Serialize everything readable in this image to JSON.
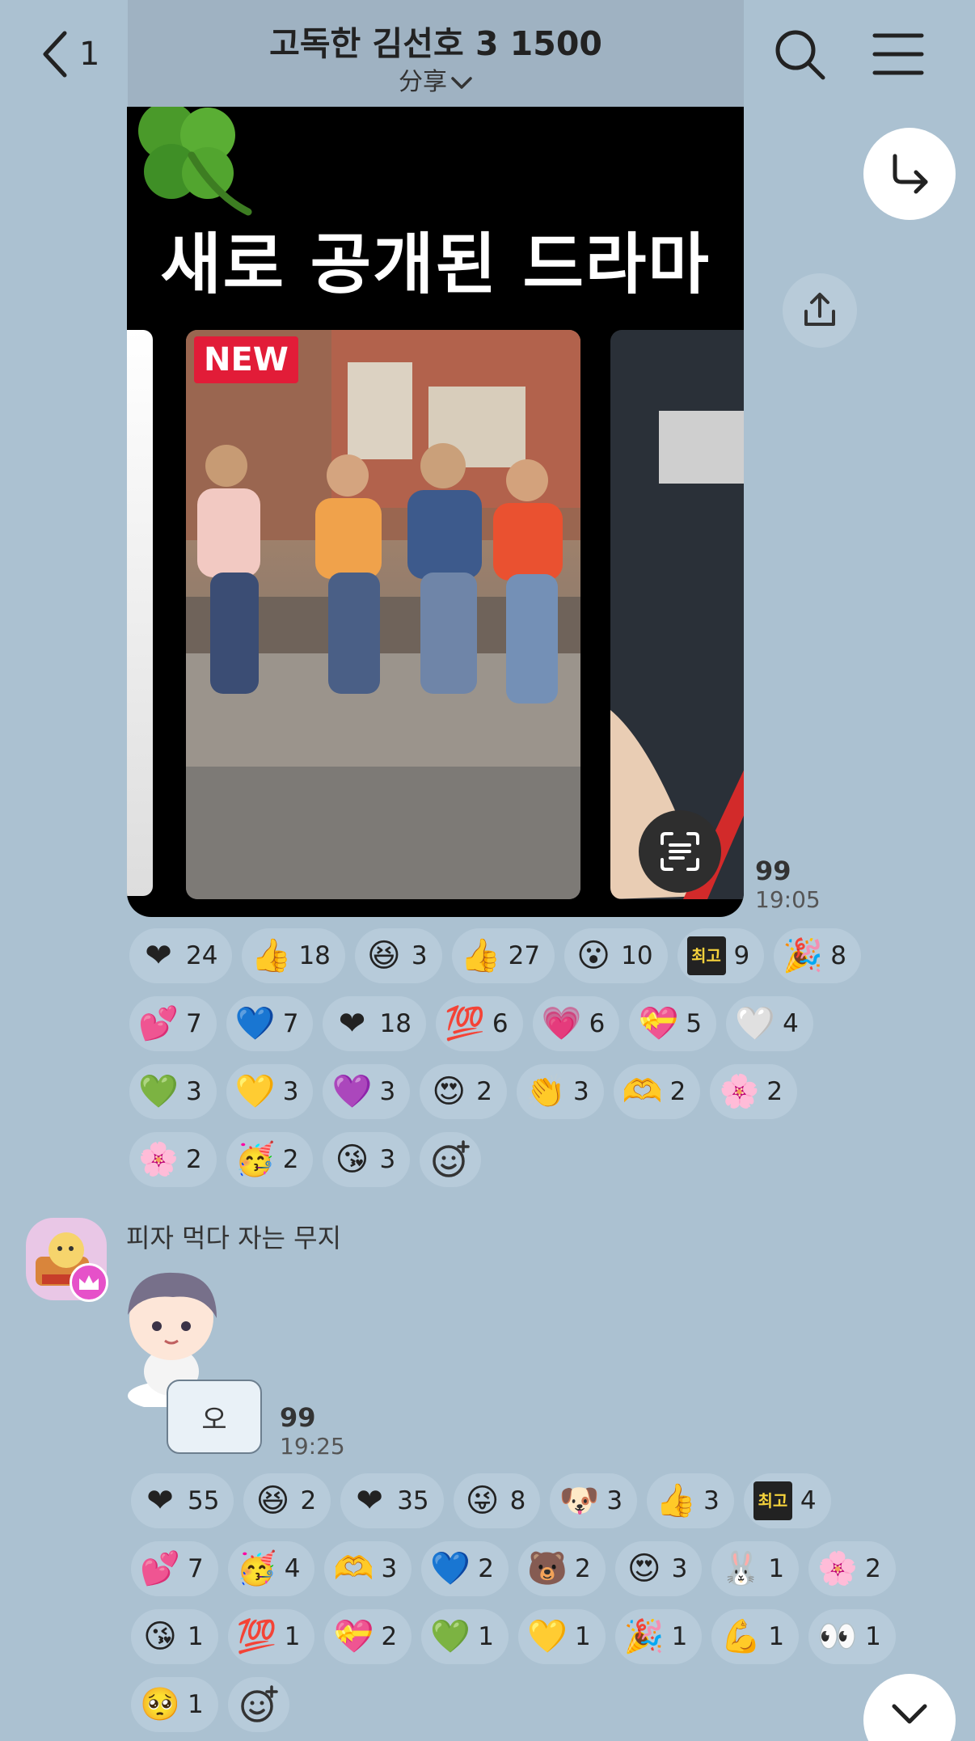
{
  "header": {
    "back_count": "1",
    "title": "고독한 김선호 3 1500",
    "subtitle": "分享"
  },
  "message1": {
    "card_title": "새로 공개된 드라마",
    "badge": "NEW",
    "unread": "99",
    "time": "19:05",
    "reactions": [
      {
        "icon": "heart-circle-icon",
        "glyph": "❤",
        "count": "24"
      },
      {
        "icon": "thumbs-up-circle-icon",
        "glyph": "👍",
        "count": "18"
      },
      {
        "icon": "grinning-squint-icon",
        "glyph": "😆",
        "count": "3"
      },
      {
        "icon": "thumbs-up-icon",
        "glyph": "👍",
        "count": "27"
      },
      {
        "icon": "surprised-face-icon",
        "glyph": "😮",
        "count": "10"
      },
      {
        "icon": "best-sticker-icon",
        "glyph": "최고",
        "count": "9"
      },
      {
        "icon": "party-popper-icon",
        "glyph": "🎉",
        "count": "8"
      },
      {
        "icon": "small-hearts-icon",
        "glyph": "💕",
        "count": "7"
      },
      {
        "icon": "blue-heart-icon",
        "glyph": "💙",
        "count": "7"
      },
      {
        "icon": "red-heart-icon",
        "glyph": "❤",
        "count": "18"
      },
      {
        "icon": "hundred-icon",
        "glyph": "💯",
        "count": "6"
      },
      {
        "icon": "sparkle-heart-icon",
        "glyph": "💗",
        "count": "6"
      },
      {
        "icon": "heart-bouquet-icon",
        "glyph": "💝",
        "count": "5"
      },
      {
        "icon": "heart-outline-icon",
        "glyph": "🤍",
        "count": "4"
      },
      {
        "icon": "green-heart-icon",
        "glyph": "💚",
        "count": "3"
      },
      {
        "icon": "yellow-heart-icon",
        "glyph": "💛",
        "count": "3"
      },
      {
        "icon": "purple-heart-icon",
        "glyph": "💜",
        "count": "3"
      },
      {
        "icon": "heart-eyes-icon",
        "glyph": "😍",
        "count": "2"
      },
      {
        "icon": "clapping-hands-icon",
        "glyph": "👏",
        "count": "3"
      },
      {
        "icon": "heart-hands-icon",
        "glyph": "🫶",
        "count": "2"
      },
      {
        "icon": "pink-flower-icon",
        "glyph": "🌸",
        "count": "2"
      },
      {
        "icon": "pink-flower-icon",
        "glyph": "🌸",
        "count": "2"
      },
      {
        "icon": "party-face-icon",
        "glyph": "🥳",
        "count": "2"
      },
      {
        "icon": "kissing-face-icon",
        "glyph": "😘",
        "count": "3"
      }
    ]
  },
  "message2": {
    "sender": "피자 먹다 자는 무지",
    "bubble_text": "오",
    "unread": "99",
    "time": "19:25",
    "reactions": [
      {
        "icon": "heart-circle-icon",
        "glyph": "❤",
        "count": "55"
      },
      {
        "icon": "grinning-squint-icon",
        "glyph": "😆",
        "count": "2"
      },
      {
        "icon": "red-heart-icon",
        "glyph": "❤",
        "count": "35"
      },
      {
        "icon": "winking-face-icon",
        "glyph": "😜",
        "count": "8"
      },
      {
        "icon": "puppy-icon",
        "glyph": "🐶",
        "count": "3"
      },
      {
        "icon": "thumbs-up-icon",
        "glyph": "👍",
        "count": "3"
      },
      {
        "icon": "best-sticker-icon",
        "glyph": "최고",
        "count": "4"
      },
      {
        "icon": "two-hearts-icon",
        "glyph": "💕",
        "count": "7"
      },
      {
        "icon": "party-face-icon",
        "glyph": "🥳",
        "count": "4"
      },
      {
        "icon": "heart-hands-icon",
        "glyph": "🫶",
        "count": "3"
      },
      {
        "icon": "blue-heart-icon",
        "glyph": "💙",
        "count": "2"
      },
      {
        "icon": "bear-sticker-icon",
        "glyph": "🐻",
        "count": "2"
      },
      {
        "icon": "heart-eyes-icon",
        "glyph": "😍",
        "count": "3"
      },
      {
        "icon": "character-sticker-icon",
        "glyph": "🐰",
        "count": "1"
      },
      {
        "icon": "pink-flower-icon",
        "glyph": "🌸",
        "count": "2"
      },
      {
        "icon": "kissing-face-icon",
        "glyph": "😘",
        "count": "1"
      },
      {
        "icon": "hundred-icon",
        "glyph": "💯",
        "count": "1"
      },
      {
        "icon": "heart-bouquet-icon",
        "glyph": "💝",
        "count": "2"
      },
      {
        "icon": "green-heart-icon",
        "glyph": "💚",
        "count": "1"
      },
      {
        "icon": "yellow-heart-icon",
        "glyph": "💛",
        "count": "1"
      },
      {
        "icon": "party-popper-icon",
        "glyph": "🎉",
        "count": "1"
      },
      {
        "icon": "flexed-biceps-icon",
        "glyph": "💪",
        "count": "1"
      },
      {
        "icon": "eyes-icon",
        "glyph": "👀",
        "count": "1"
      },
      {
        "icon": "pleading-face-icon",
        "glyph": "🥺",
        "count": "1"
      }
    ]
  }
}
